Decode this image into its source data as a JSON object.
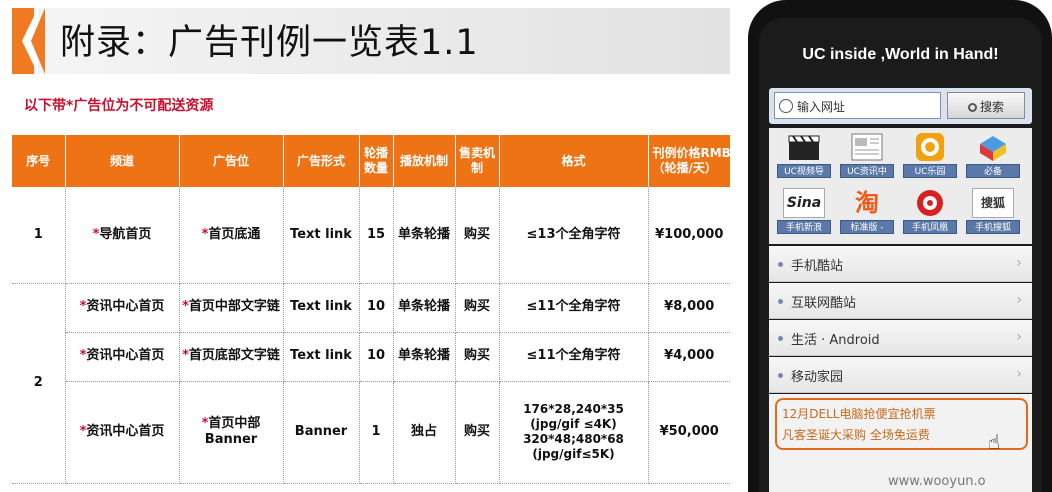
{
  "title": "附录：广告刊例一览表1.1",
  "note": "以下带*广告位为不可配送资源",
  "table": {
    "headers": [
      "序号",
      "频道",
      "广告位",
      "广告形式",
      "轮播\n数量",
      "播放机制",
      "售卖机\n制",
      "格式",
      "刊例价格RMB\n（轮播/天）"
    ],
    "star": "*",
    "rows": [
      {
        "no": "1",
        "channel": "导航首页",
        "slot": "首页底通",
        "form": "Text link",
        "count": "15",
        "play": "单条轮播",
        "sale": "购买",
        "format": "≤13个全角字符",
        "price": "¥100,000"
      },
      {
        "no": "2",
        "channel": "资讯中心首页",
        "slot": "首页中部文字链",
        "form": "Text link",
        "count": "10",
        "play": "单条轮播",
        "sale": "购买",
        "format": "≤11个全角字符",
        "price": "¥8,000"
      },
      {
        "channel": "资讯中心首页",
        "slot": "首页底部文字链",
        "form": "Text link",
        "count": "10",
        "play": "单条轮播",
        "sale": "购买",
        "format": "≤11个全角字符",
        "price": "¥4,000"
      },
      {
        "channel": "资讯中心首页",
        "slot": "首页中部\nBanner",
        "form": "Banner",
        "count": "1",
        "play": "独占",
        "sale": "购买",
        "format": "176*28,240*35\n(jpg/gif ≤4K)\n320*48;480*68\n(jpg/gif≤5K)",
        "price": "¥50,000"
      }
    ]
  },
  "phone": {
    "slogan": "UC inside ,World in Hand!",
    "url_placeholder": "输入网址",
    "search_label": "搜索",
    "apps": [
      {
        "label": "UC视频导",
        "icon": "clapperboard-icon"
      },
      {
        "label": "UC资讯中",
        "icon": "news-icon"
      },
      {
        "label": "UC乐园",
        "icon": "uc-park-icon"
      },
      {
        "label": "必备",
        "icon": "gift-box-icon"
      },
      {
        "label": "手机新浪",
        "icon": "sina-logo-icon",
        "logo_text": "Sina"
      },
      {
        "label": "标准版 -",
        "icon": "taobao-logo-icon",
        "logo_text": "淘"
      },
      {
        "label": "手机凤凰",
        "icon": "phoenix-logo-icon"
      },
      {
        "label": "手机搜狐",
        "icon": "sohu-logo-icon",
        "logo_text": "搜狐"
      }
    ],
    "menu": [
      "手机酷站",
      "互联网酷站",
      "生活 · Android",
      "移动家园"
    ],
    "promo_line1": "12月DELL电脑抢便宜抢机票",
    "promo_line2": "凡客圣诞大采购 全场免运费"
  },
  "watermark": "www.wooyun.o",
  "colors": {
    "accent": "#ee7315",
    "note_red": "#c8102e",
    "promo_orange": "#e06a1a"
  }
}
